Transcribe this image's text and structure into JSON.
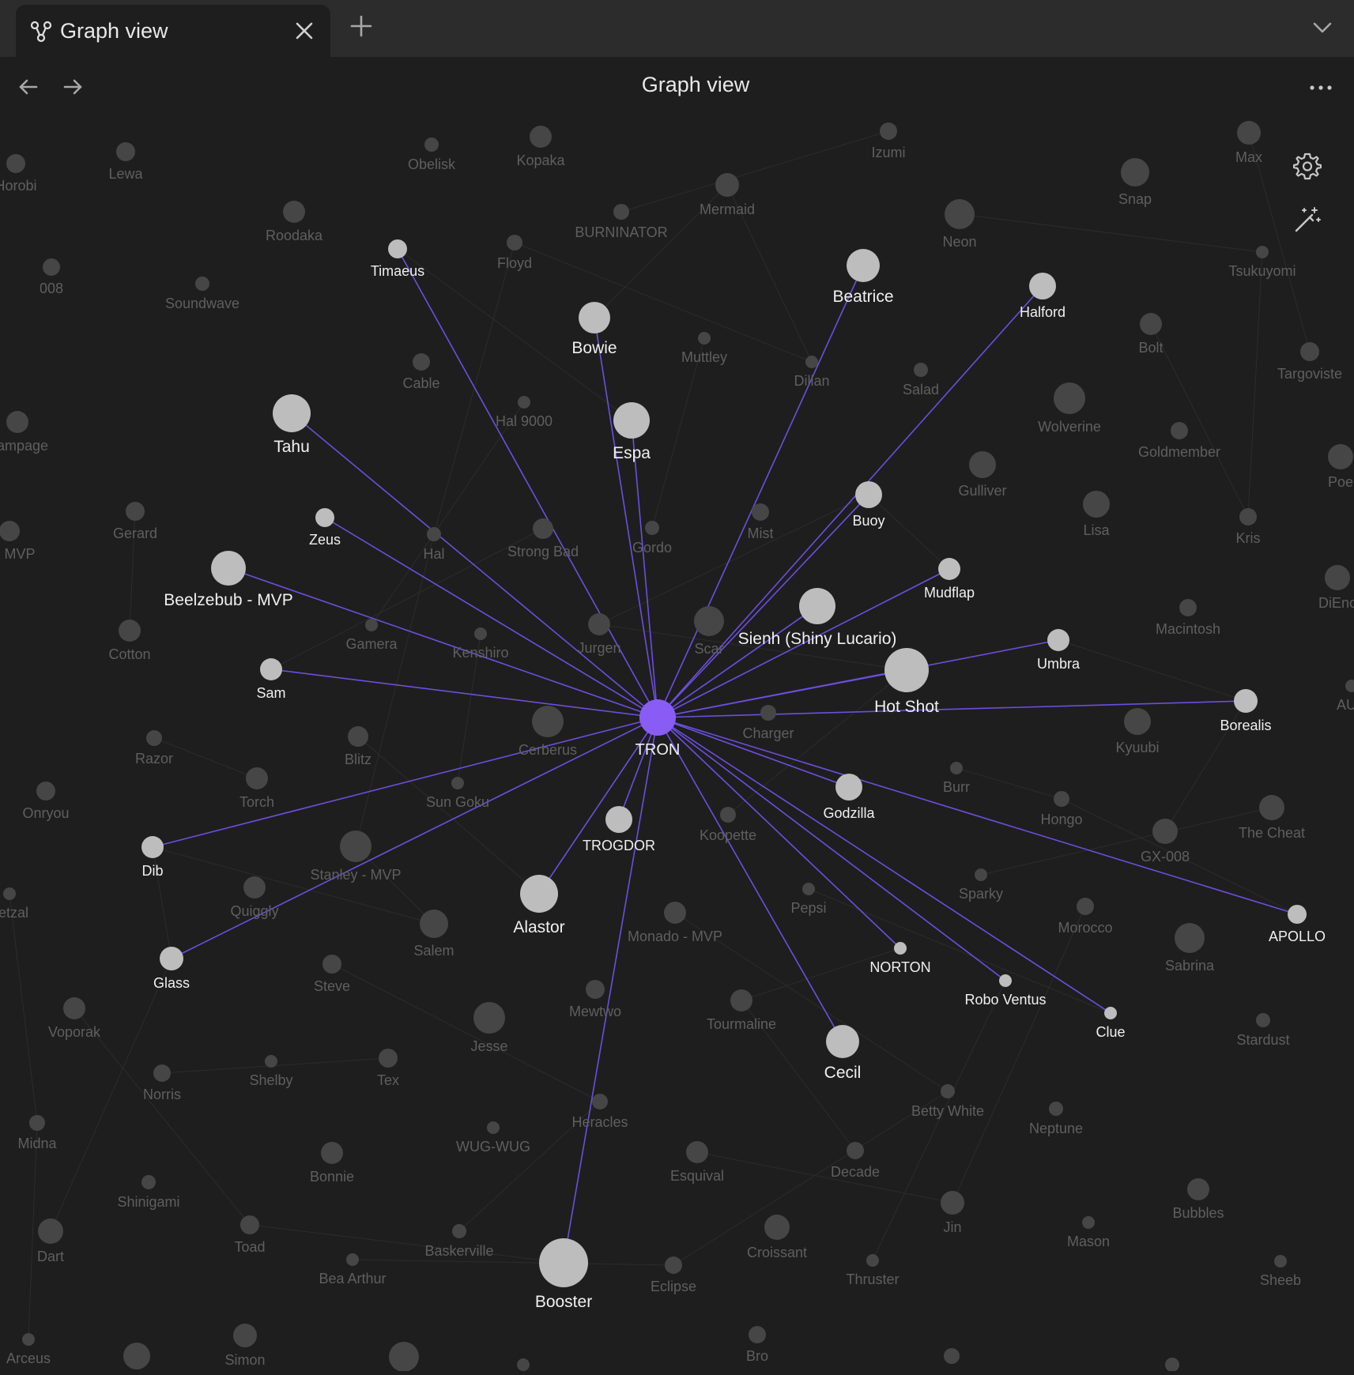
{
  "tab": {
    "title": "Graph view",
    "icon": "graph-icon"
  },
  "header": {
    "title": "Graph view"
  },
  "colors": {
    "background": "#1e1e1e",
    "tabbar": "#2c2c2c",
    "accent": "#8a5cf6",
    "link_active": "#6b4fe0",
    "node_active": "#bdbdbd",
    "node_dim": "#464646",
    "label_dim": "#5f5f5f",
    "label_active": "#f0f0f0"
  },
  "graph": {
    "center": {
      "label": "TRON"
    },
    "connected": [
      {
        "label": "Timaeus"
      },
      {
        "label": "Bowie"
      },
      {
        "label": "Espa"
      },
      {
        "label": "Beatrice"
      },
      {
        "label": "Halford"
      },
      {
        "label": "Buoy"
      },
      {
        "label": "Tahu"
      },
      {
        "label": "Zeus"
      },
      {
        "label": "Beelzebub - MVP"
      },
      {
        "label": "Sam"
      },
      {
        "label": "Mudflap"
      },
      {
        "label": "Sienh (Shiny Lucario)"
      },
      {
        "label": "Umbra"
      },
      {
        "label": "Hot Shot"
      },
      {
        "label": "Borealis"
      },
      {
        "label": "Godzilla"
      },
      {
        "label": "TROGDOR"
      },
      {
        "label": "Alastor"
      },
      {
        "label": "Dib"
      },
      {
        "label": "Glass"
      },
      {
        "label": "NORTON"
      },
      {
        "label": "Robo Ventus"
      },
      {
        "label": "Clue"
      },
      {
        "label": "APOLLO"
      },
      {
        "label": "Cecil"
      },
      {
        "label": "Booster"
      }
    ],
    "others": [
      {
        "label": "Horobi"
      },
      {
        "label": "Lewa"
      },
      {
        "label": "Obelisk"
      },
      {
        "label": "Kopaka"
      },
      {
        "label": "Izumi"
      },
      {
        "label": "Max"
      },
      {
        "label": "Mermaid"
      },
      {
        "label": "Snap"
      },
      {
        "label": "Roodaka"
      },
      {
        "label": "BURNINATOR"
      },
      {
        "label": "Neon"
      },
      {
        "label": "Floyd"
      },
      {
        "label": "008"
      },
      {
        "label": "Soundwave"
      },
      {
        "label": "Tsukuyomi"
      },
      {
        "label": "Bolt"
      },
      {
        "label": "Muttley"
      },
      {
        "label": "Cable"
      },
      {
        "label": "Dillan"
      },
      {
        "label": "Salad"
      },
      {
        "label": "Targoviste"
      },
      {
        "label": "Hal 9000"
      },
      {
        "label": "Wolverine"
      },
      {
        "label": "Rampage"
      },
      {
        "label": "Goldmember"
      },
      {
        "label": "Gulliver"
      },
      {
        "label": "Poe"
      },
      {
        "label": "Gerard"
      },
      {
        "label": "Lisa"
      },
      {
        "label": "Mist"
      },
      {
        "label": "Kris"
      },
      {
        "label": "Hal"
      },
      {
        "label": "Strong Bad"
      },
      {
        "label": "Gordo"
      },
      {
        "label": "a - MVP"
      },
      {
        "label": "DiEnc"
      },
      {
        "label": "Macintosh"
      },
      {
        "label": "Gamera"
      },
      {
        "label": "Kenshiro"
      },
      {
        "label": "Jurgen"
      },
      {
        "label": "Scar"
      },
      {
        "label": "Cotton"
      },
      {
        "label": "AUR"
      },
      {
        "label": "Charger"
      },
      {
        "label": "Kyuubi"
      },
      {
        "label": "Cerberus"
      },
      {
        "label": "Razor"
      },
      {
        "label": "Blitz"
      },
      {
        "label": "Burr"
      },
      {
        "label": "Torch"
      },
      {
        "label": "Onryou"
      },
      {
        "label": "Sun Goku"
      },
      {
        "label": "Hongo"
      },
      {
        "label": "The Cheat"
      },
      {
        "label": "Koopette"
      },
      {
        "label": "GX-008"
      },
      {
        "label": "Stanley - MVP"
      },
      {
        "label": "Sparky"
      },
      {
        "label": "uetzal"
      },
      {
        "label": "Quiggly"
      },
      {
        "label": "Pepsi"
      },
      {
        "label": "Morocco"
      },
      {
        "label": "Monado - MVP"
      },
      {
        "label": "Salem"
      },
      {
        "label": "Sabrina"
      },
      {
        "label": "Steve"
      },
      {
        "label": "Voporak"
      },
      {
        "label": "Mewtwo"
      },
      {
        "label": "Tourmaline"
      },
      {
        "label": "Jesse"
      },
      {
        "label": "Stardust"
      },
      {
        "label": "Shelby"
      },
      {
        "label": "Tex"
      },
      {
        "label": "Norris"
      },
      {
        "label": "Betty White"
      },
      {
        "label": "Heracles"
      },
      {
        "label": "Neptune"
      },
      {
        "label": "Midna"
      },
      {
        "label": "WUG-WUG"
      },
      {
        "label": "Bonnie"
      },
      {
        "label": "Esquival"
      },
      {
        "label": "Decade"
      },
      {
        "label": "Shinigami"
      },
      {
        "label": "Jin"
      },
      {
        "label": "Bubbles"
      },
      {
        "label": "Dart"
      },
      {
        "label": "Toad"
      },
      {
        "label": "Baskerville"
      },
      {
        "label": "Croissant"
      },
      {
        "label": "Mason"
      },
      {
        "label": "Bea Arthur"
      },
      {
        "label": "Eclipse"
      },
      {
        "label": "Thruster"
      },
      {
        "label": "Sheeb"
      },
      {
        "label": "Arceus"
      },
      {
        "label": "Simon"
      },
      {
        "label": "Bro"
      }
    ]
  }
}
